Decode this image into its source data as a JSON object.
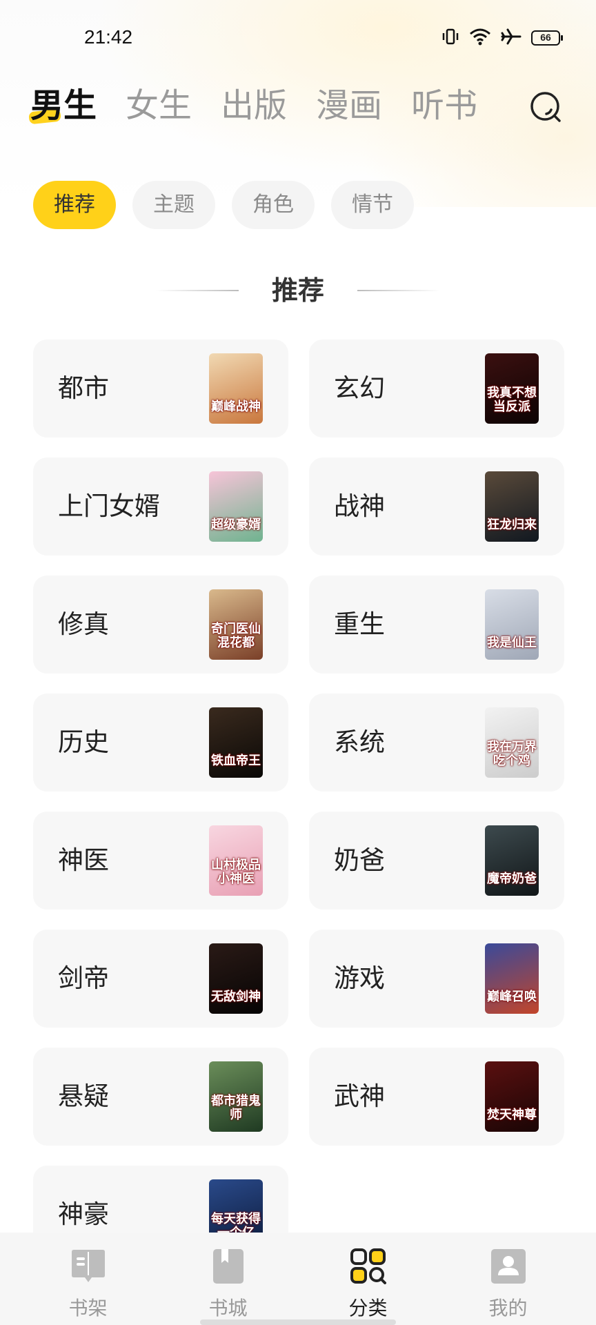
{
  "status": {
    "time": "21:42",
    "battery": "66"
  },
  "nav": {
    "tabs": [
      "男生",
      "女生",
      "出版",
      "漫画",
      "听书"
    ],
    "active": 0
  },
  "chips": [
    "推荐",
    "主题",
    "角色",
    "情节"
  ],
  "section_title": "推荐",
  "categories": [
    {
      "label": "都市",
      "cover_text": "巅峰战神",
      "cover_colors": [
        "#f1d9b3",
        "#c9773d"
      ]
    },
    {
      "label": "玄幻",
      "cover_text": "我真不想当反派",
      "cover_colors": [
        "#3b1010",
        "#0d0303"
      ]
    },
    {
      "label": "上门女婿",
      "cover_text": "超级豪婿",
      "cover_colors": [
        "#f7c4d8",
        "#6fb38f"
      ]
    },
    {
      "label": "战神",
      "cover_text": "狂龙归来",
      "cover_colors": [
        "#5a4a3a",
        "#111820"
      ]
    },
    {
      "label": "修真",
      "cover_text": "奇门医仙混花都",
      "cover_colors": [
        "#d9b98c",
        "#7a3f28"
      ]
    },
    {
      "label": "重生",
      "cover_text": "我是仙王",
      "cover_colors": [
        "#d8dde6",
        "#9fa7b6"
      ]
    },
    {
      "label": "历史",
      "cover_text": "铁血帝王",
      "cover_colors": [
        "#3a2a1e",
        "#0a0806"
      ]
    },
    {
      "label": "系统",
      "cover_text": "我在万界吃个鸡",
      "cover_colors": [
        "#f2f2f2",
        "#cccccc"
      ]
    },
    {
      "label": "神医",
      "cover_text": "山村极品小神医",
      "cover_colors": [
        "#f8d6e0",
        "#e8a0b4"
      ]
    },
    {
      "label": "奶爸",
      "cover_text": "魔帝奶爸",
      "cover_colors": [
        "#3d4a4e",
        "#111618"
      ]
    },
    {
      "label": "剑帝",
      "cover_text": "无敌剑神",
      "cover_colors": [
        "#2a1a16",
        "#060404"
      ]
    },
    {
      "label": "游戏",
      "cover_text": "巅峰召唤",
      "cover_colors": [
        "#3a4a9a",
        "#c2452a"
      ]
    },
    {
      "label": "悬疑",
      "cover_text": "都市猎鬼师",
      "cover_colors": [
        "#6b8e5a",
        "#1f3a22"
      ]
    },
    {
      "label": "武神",
      "cover_text": "焚天神尊",
      "cover_colors": [
        "#5a1010",
        "#1a0505"
      ]
    },
    {
      "label": "神豪",
      "cover_text": "每天获得一个亿",
      "cover_colors": [
        "#2a4a8a",
        "#0c1a3a"
      ]
    }
  ],
  "bottom_nav": [
    {
      "label": "书架",
      "icon": "bookshelf-icon",
      "active": false
    },
    {
      "label": "书城",
      "icon": "bookstore-icon",
      "active": false
    },
    {
      "label": "分类",
      "icon": "category-icon",
      "active": true
    },
    {
      "label": "我的",
      "icon": "profile-icon",
      "active": false
    }
  ],
  "colors": {
    "accent": "#ffd119",
    "card_bg": "#f7f7f7",
    "inactive_text": "#9a9a9a"
  }
}
